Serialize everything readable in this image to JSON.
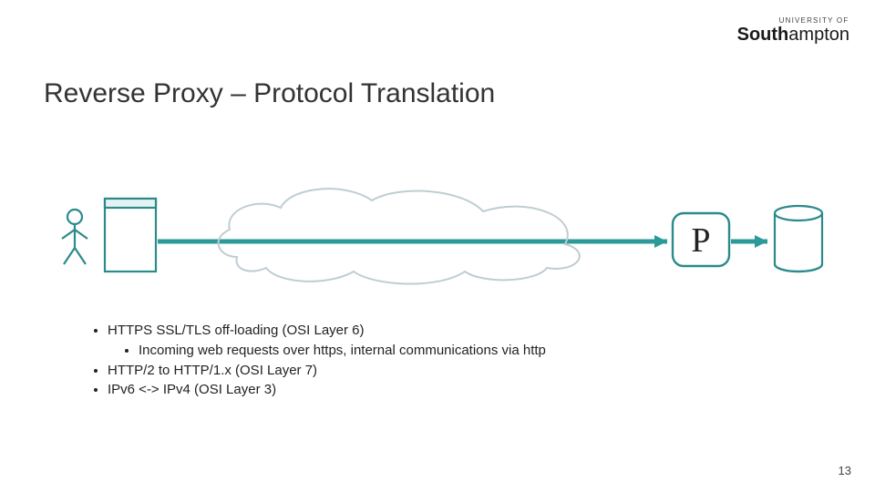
{
  "logo": {
    "small": "UNIVERSITY OF",
    "main_bold": "South",
    "main_rest": "ampton"
  },
  "title": "Reverse Proxy – Protocol Translation",
  "proxy_label": "P",
  "bullets": {
    "b1": "HTTPS  SSL/TLS off-loading (OSI Layer 6)",
    "b1a": "Incoming web requests over https, internal communications via http",
    "b2": "HTTP/2 to HTTP/1.x (OSI Layer 7)",
    "b3": "IPv6 <-> IPv4 (OSI Layer 3)"
  },
  "page_number": "13",
  "chart_data": {
    "type": "diagram",
    "title": "Reverse Proxy – Protocol Translation",
    "nodes": [
      {
        "id": "user",
        "label": "User",
        "kind": "person-icon"
      },
      {
        "id": "client",
        "label": "Client device",
        "kind": "rectangle-stack"
      },
      {
        "id": "internet",
        "label": "Internet",
        "kind": "cloud"
      },
      {
        "id": "proxy",
        "label": "P",
        "kind": "rounded-rect"
      },
      {
        "id": "server",
        "label": "Backend server / database",
        "kind": "cylinder"
      }
    ],
    "edges": [
      {
        "from": "client",
        "to": "proxy",
        "through": "internet",
        "style": "arrow"
      },
      {
        "from": "proxy",
        "to": "server",
        "style": "arrow"
      }
    ],
    "annotations": [
      "HTTPS  SSL/TLS off-loading (OSI Layer 6)",
      "Incoming web requests over https, internal communications via http",
      "HTTP/2 to HTTP/1.x (OSI Layer 7)",
      "IPv6 <-> IPv4 (OSI Layer 3)"
    ]
  }
}
